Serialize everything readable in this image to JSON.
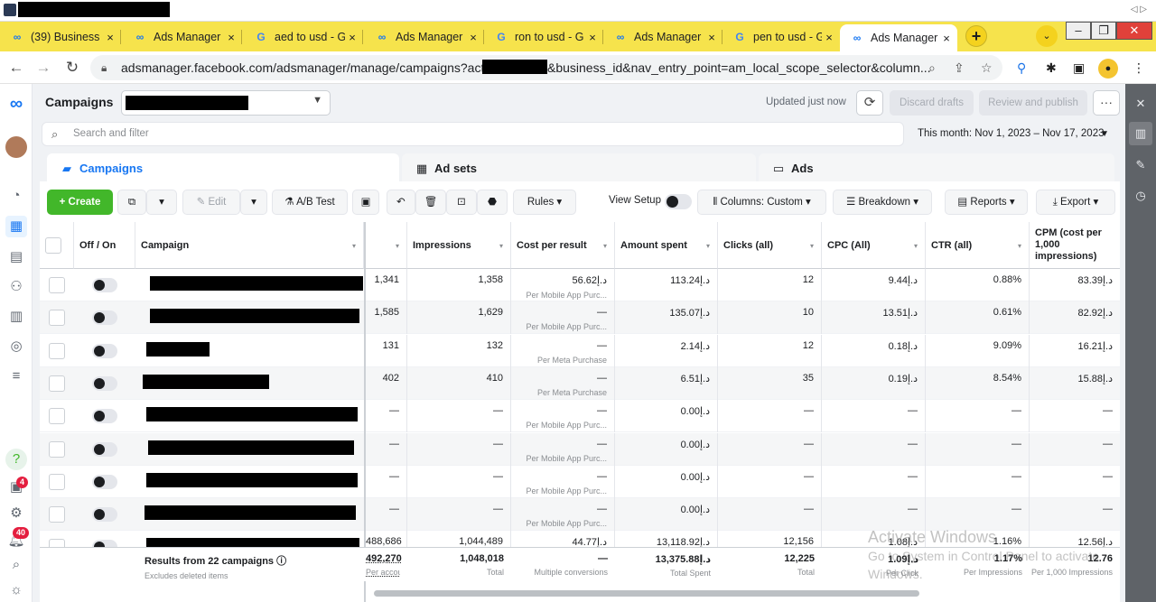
{
  "browser": {
    "tabs": [
      {
        "icon": "meta-icon",
        "title": "(39) Business"
      },
      {
        "icon": "meta-icon",
        "title": "Ads Manager"
      },
      {
        "icon": "google-icon",
        "title": "aed to usd - G"
      },
      {
        "icon": "meta-icon",
        "title": "Ads Manager"
      },
      {
        "icon": "google-icon",
        "title": "ron to usd - G"
      },
      {
        "icon": "meta-icon",
        "title": "Ads Manager"
      },
      {
        "icon": "google-icon",
        "title": "pen to usd - G"
      },
      {
        "icon": "meta-icon",
        "title": "Ads Manager"
      }
    ],
    "close_glyph": "×",
    "new_tab_glyph": "+",
    "url_part1": "adsmanager.facebook.com/adsmanager/manage/campaigns?act=",
    "url_part2": "&business_id&nav_entry_point=am_local_scope_selector&column..."
  },
  "header": {
    "title": "Campaigns",
    "updated": "Updated just now",
    "discard": "Discard drafts",
    "review": "Review and publish",
    "more": "···"
  },
  "search": {
    "placeholder": "Search and filter",
    "date_range": "This month: Nov 1, 2023 – Nov 17, 2023"
  },
  "level_tabs": {
    "campaigns": "Campaigns",
    "adsets": "Ad sets",
    "ads": "Ads"
  },
  "toolbar": {
    "create": "+ Create",
    "edit": "Edit",
    "abtest": "A/B Test",
    "rules": "Rules",
    "view_setup": "View Setup",
    "columns": "Columns: Custom",
    "breakdown": "Breakdown",
    "reports": "Reports",
    "export": "Export"
  },
  "table": {
    "headers": {
      "offon": "Off / On",
      "campaign": "Campaign",
      "impressions": "Impressions",
      "cost_per_result": "Cost per result",
      "amount_spent": "Amount spent",
      "clicks": "Clicks (all)",
      "cpc": "CPC (All)",
      "ctr": "CTR (all)",
      "cpm": "CPM (cost per 1,000 impressions)"
    },
    "rows": [
      {
        "reach": "1,341",
        "impressions": "1,358",
        "cpr": "56.62د.إ",
        "cpr_sub": "Per Mobile App Purc...",
        "spent": "113.24د.إ",
        "clicks": "12",
        "cpc": "9.44د.إ",
        "ctr": "0.88%",
        "cpm": "83.39د.إ"
      },
      {
        "reach": "1,585",
        "impressions": "1,629",
        "cpr": "—",
        "cpr_sub": "Per Mobile App Purc...",
        "spent": "135.07د.إ",
        "clicks": "10",
        "cpc": "13.51د.إ",
        "ctr": "0.61%",
        "cpm": "82.92د.إ"
      },
      {
        "reach": "131",
        "impressions": "132",
        "cpr": "—",
        "cpr_sub": "Per Meta Purchase",
        "spent": "2.14د.إ",
        "clicks": "12",
        "cpc": "0.18د.إ",
        "ctr": "9.09%",
        "cpm": "16.21د.إ"
      },
      {
        "reach": "402",
        "impressions": "410",
        "cpr": "—",
        "cpr_sub": "Per Meta Purchase",
        "spent": "6.51د.إ",
        "clicks": "35",
        "cpc": "0.19د.إ",
        "ctr": "8.54%",
        "cpm": "15.88د.إ"
      },
      {
        "reach": "—",
        "impressions": "—",
        "cpr": "—",
        "cpr_sub": "Per Mobile App Purc...",
        "spent": "0.00د.إ",
        "clicks": "—",
        "cpc": "—",
        "ctr": "—",
        "cpm": "—"
      },
      {
        "reach": "—",
        "impressions": "—",
        "cpr": "—",
        "cpr_sub": "Per Mobile App Purc...",
        "spent": "0.00د.إ",
        "clicks": "—",
        "cpc": "—",
        "ctr": "—",
        "cpm": "—"
      },
      {
        "reach": "—",
        "impressions": "—",
        "cpr": "—",
        "cpr_sub": "Per Mobile App Purc...",
        "spent": "0.00د.إ",
        "clicks": "—",
        "cpc": "—",
        "ctr": "—",
        "cpm": "—"
      },
      {
        "reach": "—",
        "impressions": "—",
        "cpr": "—",
        "cpr_sub": "Per Mobile App Purc...",
        "spent": "0.00د.إ",
        "clicks": "—",
        "cpc": "—",
        "ctr": "—",
        "cpm": "—"
      },
      {
        "reach": "488,686",
        "impressions": "1,044,489",
        "cpr": "44.77د.إ",
        "cpr_sub": "",
        "spent": "13,118.92د.إ",
        "clicks": "12,156",
        "cpc": "1.08د.إ",
        "ctr": "1.16%",
        "cpm": "12.56د.إ"
      }
    ],
    "footer": {
      "results": "Results from 22 campaigns",
      "excludes": "Excludes deleted items",
      "reach": "492,270",
      "reach_sub": "Per accounts",
      "impressions": "1,048,018",
      "impressions_sub": "Total",
      "cpr": "—",
      "cpr_sub": "Multiple conversions",
      "spent": "13,375.88د.إ",
      "spent_sub": "Total Spent",
      "clicks": "12,225",
      "clicks_sub": "Total",
      "cpc": "1.09د.إ",
      "cpc_sub": "Per Click",
      "ctr": "1.17%",
      "ctr_sub": "Per Impressions",
      "cpm": "12.76",
      "cpm_sub": "Per 1,000 Impressions"
    }
  },
  "sidebar_badges": {
    "notifications": "4",
    "alerts": "40"
  },
  "watermark": {
    "line1": "Activate Windows",
    "line2": "Go to System in Control Panel to activate",
    "line3": "Windows."
  }
}
